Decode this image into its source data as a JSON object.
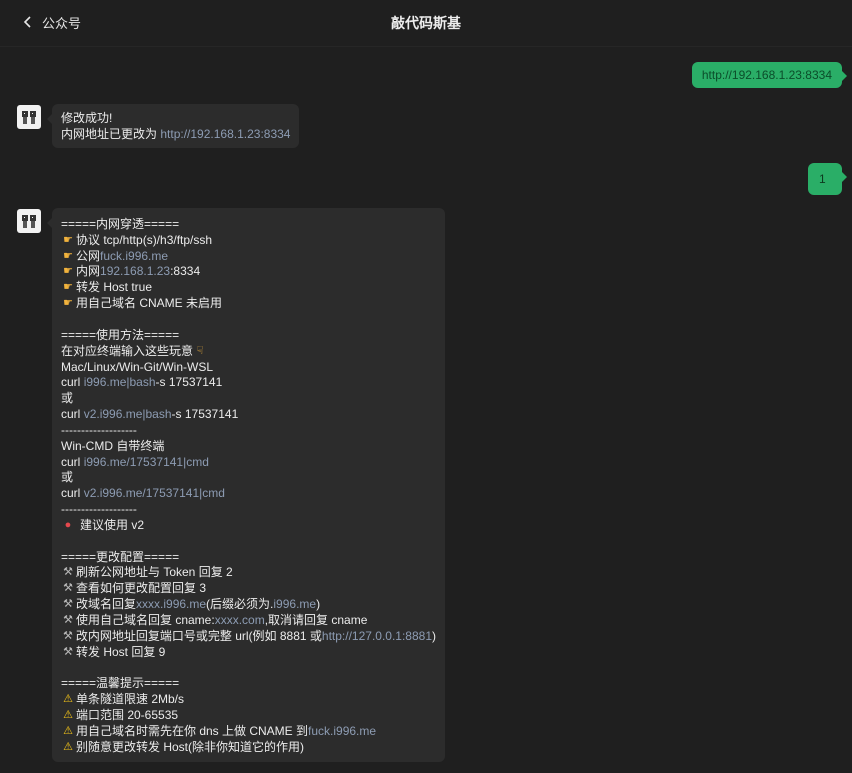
{
  "header": {
    "back_label": "公众号",
    "title": "敲代码斯基"
  },
  "messages": {
    "sent1": "http://192.168.1.23:8334",
    "reply1": {
      "line1": "修改成功!",
      "line2_prefix": "内网地址已更改为 ",
      "line2_link": "http://192.168.1.23:8334"
    },
    "sent2": "1",
    "reply2": {
      "h1": "=====内网穿透=====",
      "protocol": "协议 tcp/http(s)/h3/ftp/ssh",
      "public_label": "公网 ",
      "public_link": "fuck.i996.me",
      "lan_label": "内网 ",
      "lan_link": "192.168.1.23",
      "lan_port": ":8334",
      "forward_host": "转发 Host true",
      "own_domain": "用自己域名 CNAME 未启用",
      "h2": "=====使用方法=====",
      "hint": "在对应终端输入这些玩意",
      "platforms": "Mac/Linux/Win-Git/Win-WSL",
      "curl": "curl ",
      "cmd1_link": "i996.me|bash",
      "cmd1_suffix": " -s 17537141",
      "or": "或",
      "cmd2_link": "v2.i996.me|bash",
      "cmd2_suffix": " -s 17537141",
      "sep": "-------------------",
      "wincmd": "Win-CMD 自带终端",
      "cmd3_link": "i996.me/17537141|cmd",
      "cmd4_link": "v2.i996.me/17537141|cmd",
      "recommend": "建议使用 v2",
      "h3": "=====更改配置=====",
      "cfg1": "刷新公网地址与 Token 回复 2",
      "cfg2": "查看如何更改配置回复 3",
      "cfg3_a": "改域名回复 ",
      "cfg3_link1": "xxxx.i996.me",
      "cfg3_b": "(后缀必须为.",
      "cfg3_link2": "i996.me",
      "cfg3_c": ")",
      "cfg4_a": "使用自己域名回复 cname:",
      "cfg4_link": "xxxx.com",
      "cfg4_b": ",取消请回复 cname",
      "cfg5_a": "改内网地址回复端口号或完整 url(例如 8881 或 ",
      "cfg5_link": "http://127.0.0.1:8881",
      "cfg5_b": ")",
      "cfg6": "转发 Host 回复 9",
      "h4": "=====温馨提示=====",
      "tip1": "单条隧道限速 2Mb/s",
      "tip2": "端口范围 20-65535",
      "tip3_a": "用自己域名时需先在你 dns 上做 CNAME 到 ",
      "tip3_link": "fuck.i996.me",
      "tip4": "别随意更改转发 Host(除非你知道它的作用)"
    }
  },
  "icons": {
    "hand": "backhand-index-pointing-right",
    "hand_down": "backhand-index-pointing-down",
    "tool": "hammer-and-wrench",
    "warn": "warning",
    "bug": "lady-beetle"
  },
  "colors": {
    "background": "#1f1f1f",
    "bubble_in": "#2c2c2c",
    "bubble_out": "#2aae67",
    "link": "#8d9cb3"
  }
}
